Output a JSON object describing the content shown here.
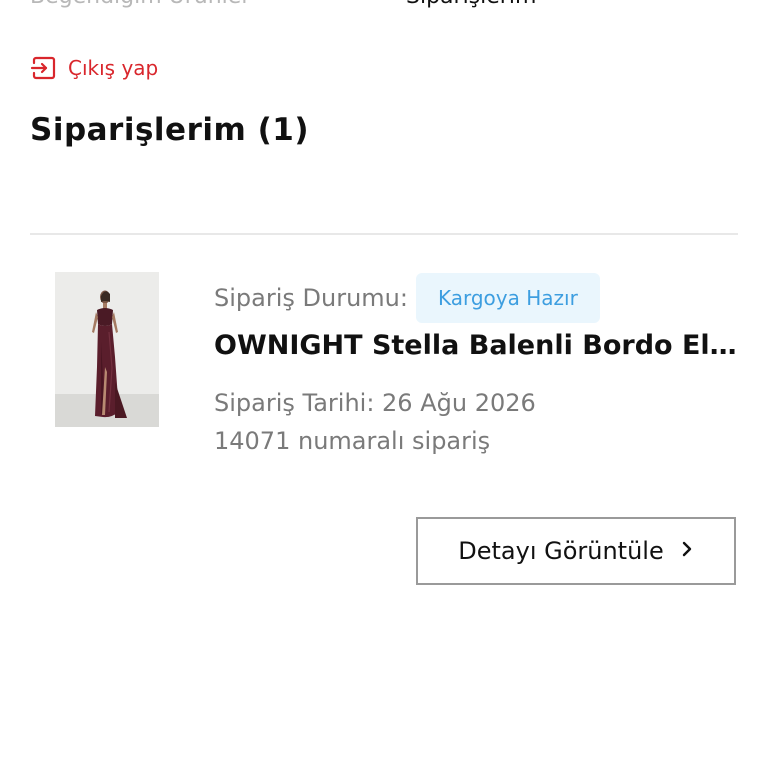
{
  "nav": {
    "left_label": "Beğendiğim Ürünler",
    "right_label": "Siparişlerim"
  },
  "logout": {
    "label": "Çıkış yap",
    "icon": "logout-icon",
    "color": "#d9262c"
  },
  "page_title": "Siparişlerim (1)",
  "orders": [
    {
      "status_label": "Sipariş Durumu:",
      "status_value": "Kargoya Hazır",
      "product_name": "OWNIGHT Stella Balenli Bordo El...",
      "order_date": "Sipariş Tarihi: 26 Ağu 2026",
      "order_number": "14071 numaralı sipariş",
      "detail_button_label": "Detayı Görüntüle",
      "detail_button_icon": "chevron-right-icon"
    }
  ],
  "colors": {
    "accent_red": "#d9262c",
    "badge_bg": "#eaf6fd",
    "badge_text": "#3d9ee0",
    "muted_text": "#7a7a7a"
  }
}
